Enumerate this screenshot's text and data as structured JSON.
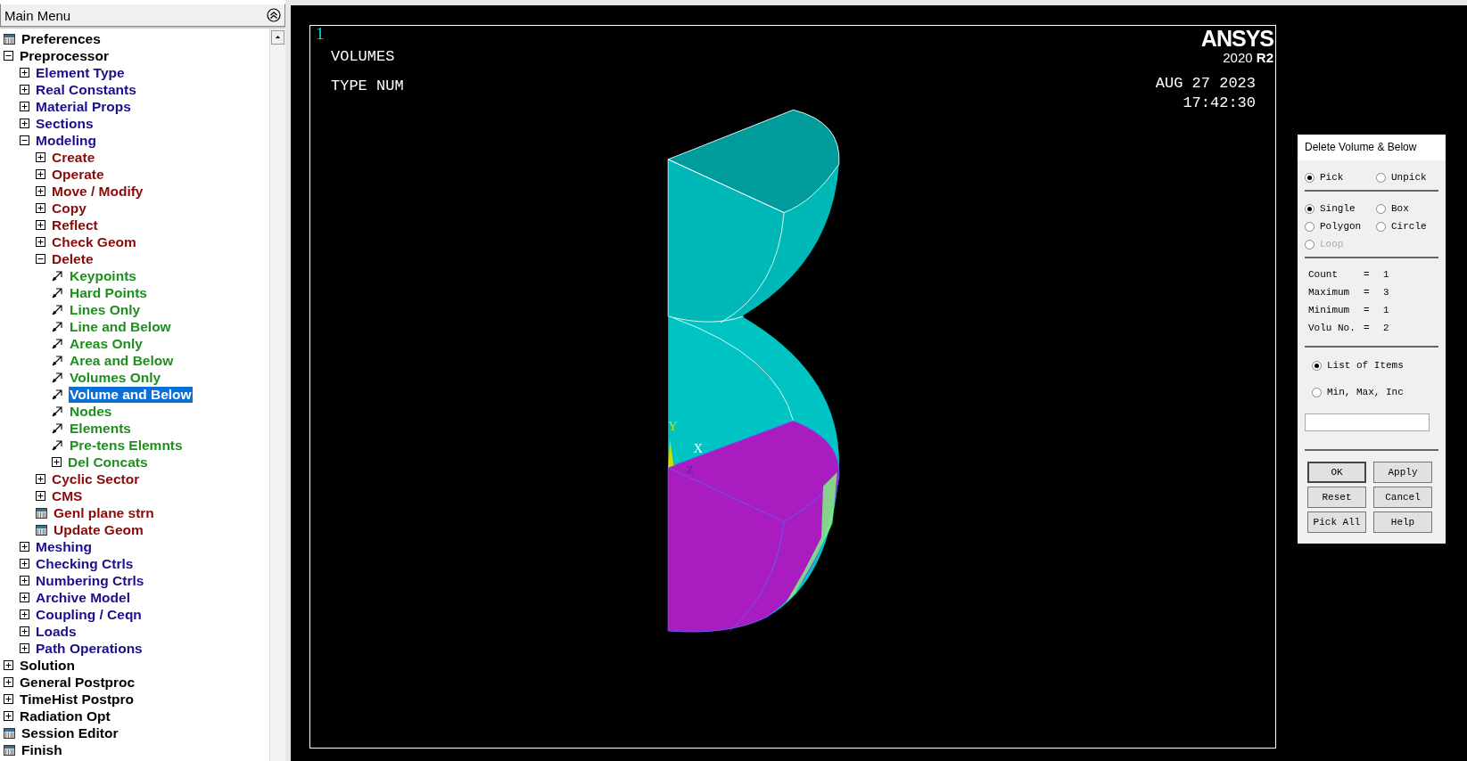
{
  "menu": {
    "title": "Main Menu",
    "items": [
      {
        "label": "Preferences",
        "kind": "dialog",
        "selected": false
      },
      {
        "label": "Preprocessor",
        "kind": "folder",
        "expanded": true,
        "selected": false,
        "children": [
          {
            "label": "Element Type",
            "kind": "folder",
            "expanded": false,
            "selected": false
          },
          {
            "label": "Real Constants",
            "kind": "folder",
            "expanded": false,
            "selected": false
          },
          {
            "label": "Material Props",
            "kind": "folder",
            "expanded": false,
            "selected": false
          },
          {
            "label": "Sections",
            "kind": "folder",
            "expanded": false,
            "selected": false
          },
          {
            "label": "Modeling",
            "kind": "folder",
            "expanded": true,
            "selected": false,
            "children": [
              {
                "label": "Create",
                "kind": "folder",
                "expanded": false,
                "selected": false
              },
              {
                "label": "Operate",
                "kind": "folder",
                "expanded": false,
                "selected": false
              },
              {
                "label": "Move / Modify",
                "kind": "folder",
                "expanded": false,
                "selected": false
              },
              {
                "label": "Copy",
                "kind": "folder",
                "expanded": false,
                "selected": false
              },
              {
                "label": "Reflect",
                "kind": "folder",
                "expanded": false,
                "selected": false
              },
              {
                "label": "Check Geom",
                "kind": "folder",
                "expanded": false,
                "selected": false
              },
              {
                "label": "Delete",
                "kind": "folder",
                "expanded": true,
                "selected": false,
                "children": [
                  {
                    "label": "Keypoints",
                    "kind": "pick",
                    "selected": false
                  },
                  {
                    "label": "Hard Points",
                    "kind": "pick",
                    "selected": false
                  },
                  {
                    "label": "Lines Only",
                    "kind": "pick",
                    "selected": false
                  },
                  {
                    "label": "Line and Below",
                    "kind": "pick",
                    "selected": false
                  },
                  {
                    "label": "Areas Only",
                    "kind": "pick",
                    "selected": false
                  },
                  {
                    "label": "Area and Below",
                    "kind": "pick",
                    "selected": false
                  },
                  {
                    "label": "Volumes Only",
                    "kind": "pick",
                    "selected": false
                  },
                  {
                    "label": "Volume and Below",
                    "kind": "pick",
                    "selected": true
                  },
                  {
                    "label": "Nodes",
                    "kind": "pick",
                    "selected": false
                  },
                  {
                    "label": "Elements",
                    "kind": "pick",
                    "selected": false
                  },
                  {
                    "label": "Pre-tens Elemnts",
                    "kind": "pick",
                    "selected": false
                  },
                  {
                    "label": "Del Concats",
                    "kind": "folder",
                    "expanded": false,
                    "selected": false
                  }
                ]
              },
              {
                "label": "Cyclic Sector",
                "kind": "folder",
                "expanded": false,
                "selected": false
              },
              {
                "label": "CMS",
                "kind": "folder",
                "expanded": false,
                "selected": false
              },
              {
                "label": "Genl plane strn",
                "kind": "dialog",
                "selected": false
              },
              {
                "label": "Update Geom",
                "kind": "dialog",
                "selected": false
              }
            ]
          },
          {
            "label": "Meshing",
            "kind": "folder",
            "expanded": false,
            "selected": false
          },
          {
            "label": "Checking Ctrls",
            "kind": "folder",
            "expanded": false,
            "selected": false
          },
          {
            "label": "Numbering Ctrls",
            "kind": "folder",
            "expanded": false,
            "selected": false
          },
          {
            "label": "Archive Model",
            "kind": "folder",
            "expanded": false,
            "selected": false
          },
          {
            "label": "Coupling / Ceqn",
            "kind": "folder",
            "expanded": false,
            "selected": false
          },
          {
            "label": "Loads",
            "kind": "folder",
            "expanded": false,
            "selected": false
          },
          {
            "label": "Path Operations",
            "kind": "folder",
            "expanded": false,
            "selected": false
          }
        ]
      },
      {
        "label": "Solution",
        "kind": "folder",
        "expanded": false,
        "selected": false
      },
      {
        "label": "General Postproc",
        "kind": "folder",
        "expanded": false,
        "selected": false
      },
      {
        "label": "TimeHist Postpro",
        "kind": "folder",
        "expanded": false,
        "selected": false
      },
      {
        "label": "Radiation Opt",
        "kind": "folder",
        "expanded": false,
        "selected": false
      },
      {
        "label": "Session Editor",
        "kind": "dialog",
        "selected": false
      },
      {
        "label": "Finish",
        "kind": "dialog",
        "selected": false
      }
    ]
  },
  "graphics": {
    "window_number": "1",
    "plot_title": "VOLUMES",
    "plot_subtitle": "TYPE NUM",
    "logo": "ANSYS",
    "version": "2020 **R2**",
    "date": "AUG 27 2023",
    "time": "17:42:30",
    "axes": [
      "Y",
      "X",
      "Z"
    ]
  },
  "picker": {
    "title": "Delete Volume & Below",
    "mode": [
      {
        "label": "Pick",
        "selected": true
      },
      {
        "label": "Unpick",
        "selected": false
      }
    ],
    "shape": [
      {
        "label": "Single",
        "selected": true,
        "disabled": false
      },
      {
        "label": "Box",
        "selected": false,
        "disabled": false
      },
      {
        "label": "Polygon",
        "selected": false,
        "disabled": false
      },
      {
        "label": "Circle",
        "selected": false,
        "disabled": false
      },
      {
        "label": "Loop",
        "selected": false,
        "disabled": true
      }
    ],
    "stats": [
      {
        "label": "Count",
        "sign": "=",
        "value": "1"
      },
      {
        "label": "Maximum",
        "sign": "=",
        "value": "3"
      },
      {
        "label": "Minimum",
        "sign": "=",
        "value": "1"
      },
      {
        "label": "Volu No.",
        "sign": "=",
        "value": "2"
      }
    ],
    "entry": [
      {
        "label": "List of Items",
        "selected": true
      },
      {
        "label": "Min, Max, Inc",
        "selected": false
      }
    ],
    "buttons": [
      "OK",
      "Apply",
      "Reset",
      "Cancel",
      "Pick All",
      "Help"
    ]
  }
}
